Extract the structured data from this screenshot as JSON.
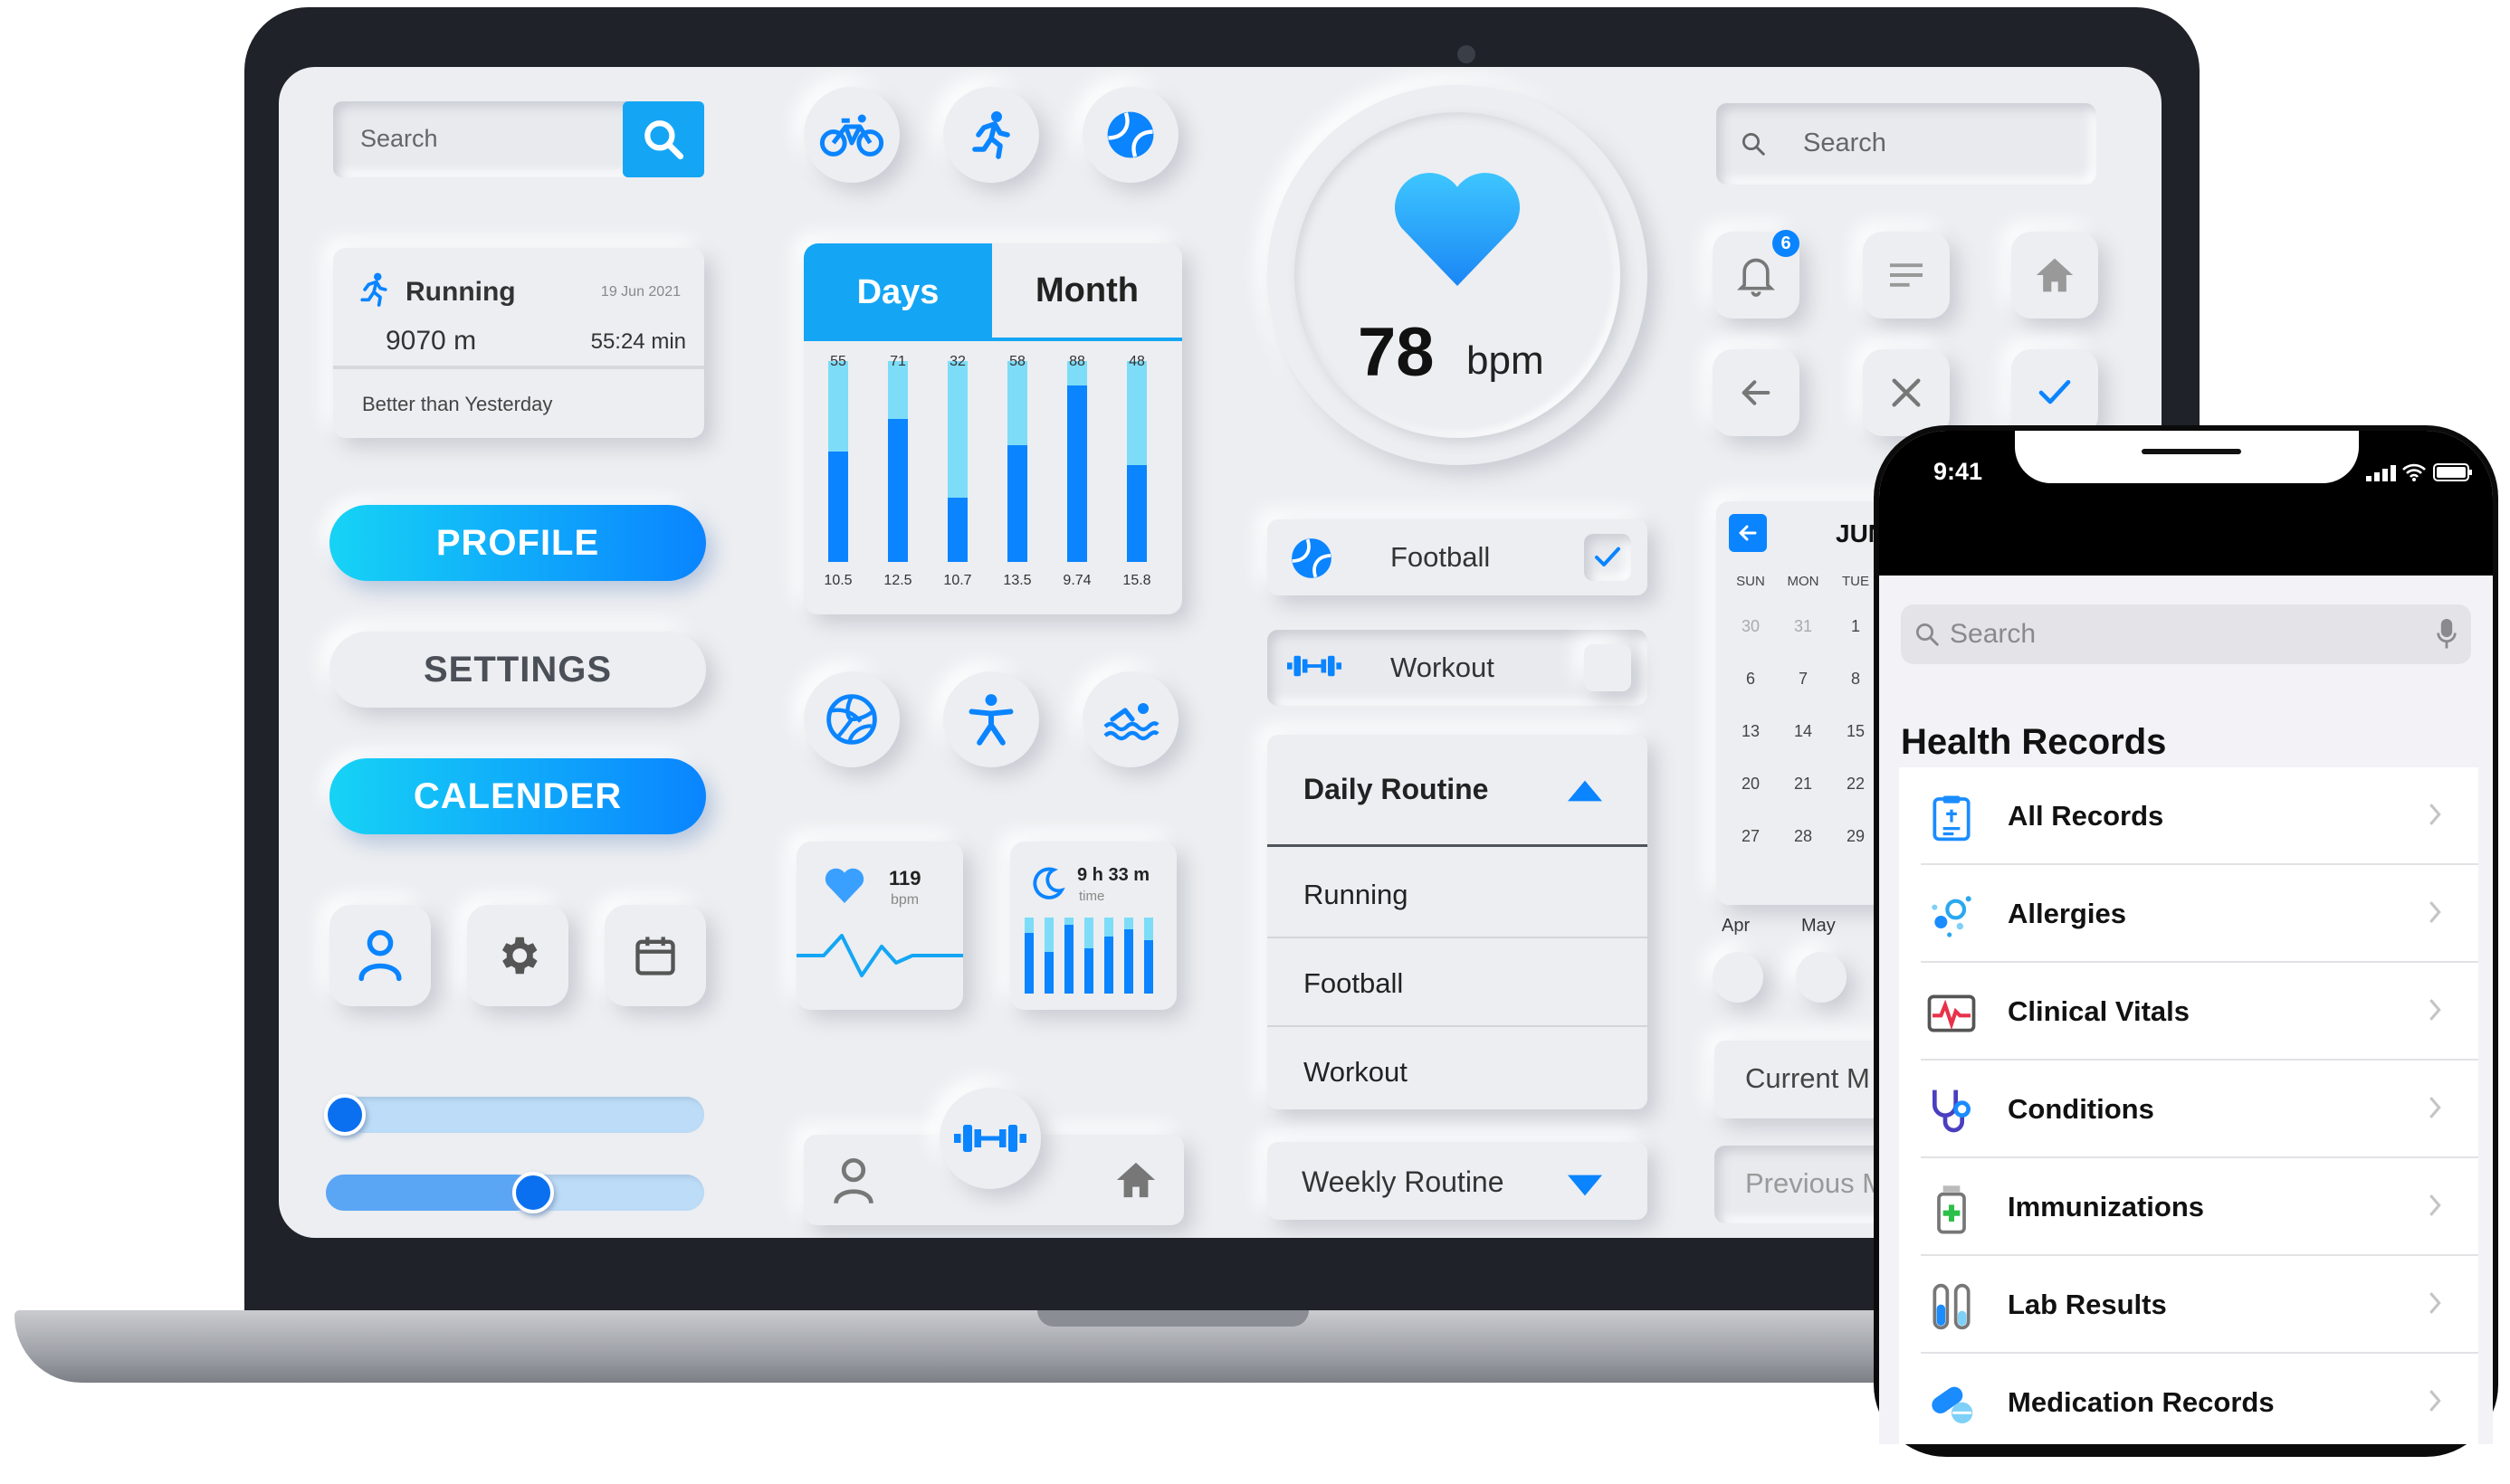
{
  "dashboard": {
    "search": {
      "placeholder": "Search"
    },
    "running_card": {
      "title": "Running",
      "date": "19 Jun 2021",
      "distance": "9070 m",
      "duration": "55:24 min",
      "comparison": "Better than Yesterday"
    },
    "buttons": {
      "profile": "PROFILE",
      "settings": "SETTINGS",
      "calender": "CALENDER"
    },
    "sliders": [
      {
        "value": 0.0
      },
      {
        "value": 0.5
      }
    ],
    "activity_icons_top": [
      "bicycle-icon",
      "running-icon",
      "tennis-ball-icon"
    ],
    "activity_icons_bottom": [
      "volleyball-icon",
      "fitness-person-icon",
      "swimming-icon"
    ],
    "tabs": {
      "days": "Days",
      "month": "Month"
    },
    "chart_data": {
      "type": "bar",
      "top_labels": [
        "55",
        "71",
        "32",
        "58",
        "88",
        "48"
      ],
      "categories": [
        "10.5",
        "12.5",
        "10.7",
        "13.5",
        "9.74",
        "15.8"
      ],
      "values": [
        55,
        71,
        32,
        58,
        88,
        48
      ]
    },
    "heart_widget": {
      "value": "119",
      "unit": "bpm"
    },
    "sleep_widget": {
      "value": "9 h 33 m",
      "unit": "time"
    },
    "heart_rate": {
      "value": "78",
      "unit": "bpm"
    },
    "checkbox_rows": [
      {
        "label": "Football",
        "checked": true
      },
      {
        "label": "Workout",
        "checked": false
      }
    ],
    "daily_routine": {
      "title": "Daily Routine",
      "items": [
        "Running",
        "Football",
        "Workout"
      ]
    },
    "weekly_routine": {
      "title": "Weekly Routine"
    },
    "search2": {
      "placeholder": "Search"
    },
    "notifications": {
      "count": "6"
    },
    "calendar": {
      "month": "JUN",
      "weekdays": [
        "SUN",
        "MON",
        "TUE"
      ],
      "rows": [
        [
          "30",
          "31",
          "1"
        ],
        [
          "6",
          "7",
          "8"
        ],
        [
          "13",
          "14",
          "15"
        ],
        [
          "20",
          "21",
          "22"
        ],
        [
          "27",
          "28",
          "29"
        ]
      ],
      "months_small": [
        "Apr",
        "May"
      ]
    },
    "current_month": "Current M",
    "previous_month": "Previous M"
  },
  "phone": {
    "time": "9:41",
    "search_placeholder": "Search",
    "title": "Health Records",
    "records": [
      {
        "label": "All Records",
        "icon": "clipboard-icon"
      },
      {
        "label": "Allergies",
        "icon": "allergen-icon"
      },
      {
        "label": "Clinical Vitals",
        "icon": "vitals-monitor-icon"
      },
      {
        "label": "Conditions",
        "icon": "stethoscope-icon"
      },
      {
        "label": "Immunizations",
        "icon": "vaccine-vial-icon"
      },
      {
        "label": "Lab Results",
        "icon": "test-tubes-icon"
      },
      {
        "label": "Medication Records",
        "icon": "pills-icon"
      }
    ],
    "colors": {
      "accent": "#0a84ff",
      "cyan": "#14a6f4"
    }
  }
}
